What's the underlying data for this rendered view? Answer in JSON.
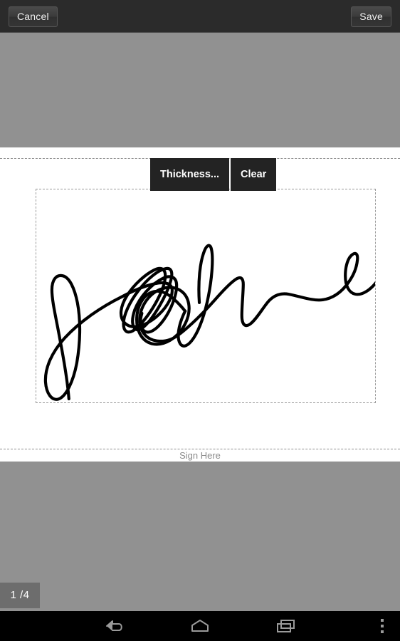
{
  "topbar": {
    "cancel_label": "Cancel",
    "save_label": "Save",
    "background": "#2b2b2b"
  },
  "toolbar": {
    "thickness_label": "Thickness...",
    "clear_label": "Clear",
    "background": "#232323",
    "text_color": "#ffffff"
  },
  "document": {
    "page_background": "#919191",
    "sheet_background": "#ffffff",
    "sign_here_label": "Sign Here",
    "sign_here_color": "#8a8a8a",
    "dashed_border_color": "#9a9a9a"
  },
  "signature": {
    "ink_color": "#000000",
    "stroke_width": 4,
    "is_drawn": true,
    "description": "handwritten cursive signature"
  },
  "page_indicator": {
    "current": "1",
    "total": "/4",
    "text": "1  /4",
    "background": "#6d6d6d"
  },
  "navbar": {
    "background": "#000000",
    "icon_color": "#9a9a9a",
    "items": [
      {
        "name": "back-icon",
        "label": "Back"
      },
      {
        "name": "home-icon",
        "label": "Home"
      },
      {
        "name": "recents-icon",
        "label": "Recent apps"
      },
      {
        "name": "overflow-menu-icon",
        "label": "More options"
      }
    ]
  }
}
